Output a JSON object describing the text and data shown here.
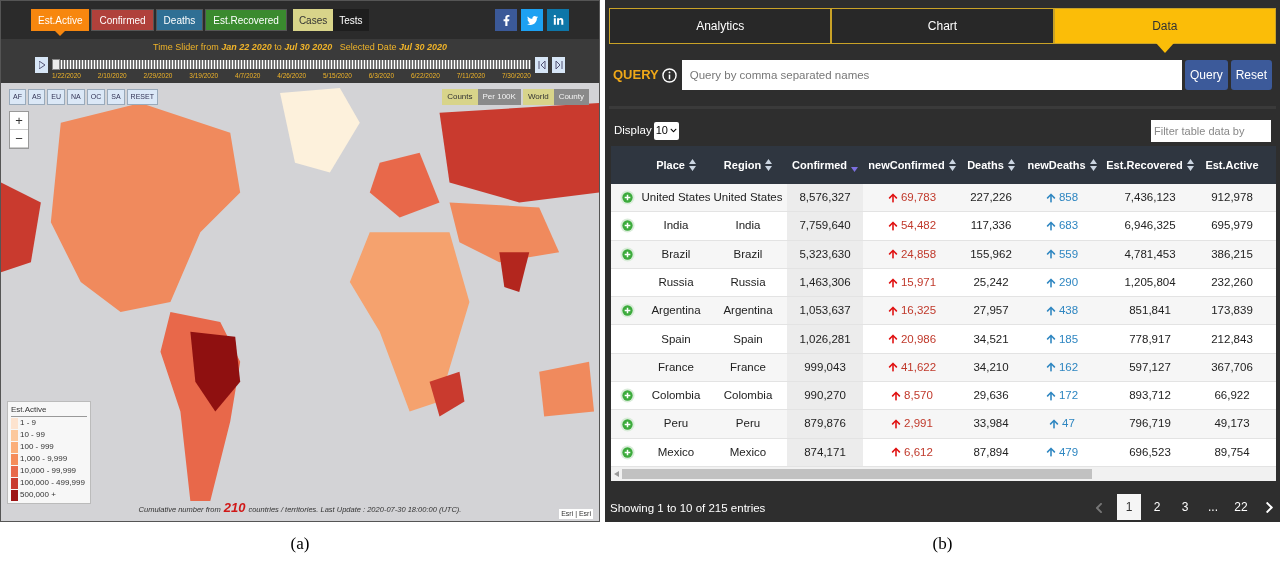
{
  "map_panel": {
    "metric_tabs": [
      {
        "label": "Est.Active",
        "selected": true,
        "color": "#f7870f"
      },
      {
        "label": "Confirmed",
        "selected": false,
        "color": "#b0413b"
      },
      {
        "label": "Deaths",
        "selected": false,
        "color": "#2f6f94"
      },
      {
        "label": "Est.Recovered",
        "selected": false,
        "color": "#3a8a2e"
      }
    ],
    "type_tabs": [
      {
        "label": "Cases",
        "selected": true
      },
      {
        "label": "Tests",
        "selected": false
      }
    ],
    "slider": {
      "title": "Time Slider from **Jan 22 2020** to **Jul 30 2020**   Selected Date **Jul 30 2020**",
      "level": 0.0,
      "ticks": [
        "1/22/2020",
        "2/10/2020",
        "2/29/2020",
        "3/19/2020",
        "4/7/2020",
        "4/26/2020",
        "5/15/2020",
        "6/3/2020",
        "6/22/2020",
        "7/11/2020",
        "7/30/2020"
      ]
    },
    "region_buttons": [
      "AF",
      "AS",
      "EU",
      "NA",
      "OC",
      "SA",
      "RESET"
    ],
    "mode_toggle": [
      {
        "label": "Counts",
        "selected": true
      },
      {
        "label": "Per 100K",
        "selected": false
      }
    ],
    "scope_toggle": [
      {
        "label": "World",
        "selected": true
      },
      {
        "label": "County",
        "selected": false
      }
    ],
    "zoom": [
      "+",
      "−"
    ],
    "legend": {
      "title": "Est.Active",
      "items": [
        {
          "label": "1 - 9",
          "color": "#fde3cf"
        },
        {
          "label": "10 - 99",
          "color": "#fcc89c"
        },
        {
          "label": "100 - 999",
          "color": "#fbae79"
        },
        {
          "label": "1,000 - 9,999",
          "color": "#f58c5a"
        },
        {
          "label": "10,000 - 99,999",
          "color": "#e8684a"
        },
        {
          "label": "100,000 - 499,999",
          "color": "#c93a2e"
        },
        {
          "label": "500,000 +",
          "color": "#9e1414"
        }
      ]
    },
    "footer": {
      "prefix": "Cumulative number from",
      "count": "210",
      "suffix": "countries / territories. Last Update : 2020-07-30 18:00:00 (UTC)."
    },
    "attribution": "Esri | Esri",
    "caption": "(a)"
  },
  "data_panel": {
    "tabs": [
      {
        "label": "Analytics",
        "selected": false
      },
      {
        "label": "Chart",
        "selected": false
      },
      {
        "label": "Data",
        "selected": true
      }
    ],
    "query": {
      "label": "QUERY",
      "placeholder": "Query by comma separated names",
      "buttons": [
        "Query",
        "Reset"
      ]
    },
    "display": {
      "label": "Display",
      "value": "10"
    },
    "filter": {
      "placeholder": "Filter table data by"
    },
    "columns": [
      {
        "label": "Place",
        "sorted": false
      },
      {
        "label": "Region",
        "sorted": false
      },
      {
        "label": "Confirmed",
        "sorted": true
      },
      {
        "label": "newConfirmed",
        "sorted": false
      },
      {
        "label": "Deaths",
        "sorted": false
      },
      {
        "label": "newDeaths",
        "sorted": false
      },
      {
        "label": "Est.Recovered",
        "sorted": false
      },
      {
        "label": "Est.Active"
      }
    ],
    "rows": [
      {
        "expandable": true,
        "cells": [
          "United States",
          "United States",
          "8,576,327",
          "69,783",
          "227,226",
          "858",
          "7,436,123",
          "912,978"
        ]
      },
      {
        "expandable": true,
        "cells": [
          "India",
          "India",
          "7,759,640",
          "54,482",
          "117,336",
          "683",
          "6,946,325",
          "695,979"
        ]
      },
      {
        "expandable": true,
        "cells": [
          "Brazil",
          "Brazil",
          "5,323,630",
          "24,858",
          "155,962",
          "559",
          "4,781,453",
          "386,215"
        ]
      },
      {
        "expandable": false,
        "cells": [
          "Russia",
          "Russia",
          "1,463,306",
          "15,971",
          "25,242",
          "290",
          "1,205,804",
          "232,260"
        ]
      },
      {
        "expandable": true,
        "cells": [
          "Argentina",
          "Argentina",
          "1,053,637",
          "16,325",
          "27,957",
          "438",
          "851,841",
          "173,839"
        ]
      },
      {
        "expandable": false,
        "cells": [
          "Spain",
          "Spain",
          "1,026,281",
          "20,986",
          "34,521",
          "185",
          "778,917",
          "212,843"
        ]
      },
      {
        "expandable": false,
        "cells": [
          "France",
          "France",
          "999,043",
          "41,622",
          "34,210",
          "162",
          "597,127",
          "367,706"
        ]
      },
      {
        "expandable": true,
        "cells": [
          "Colombia",
          "Colombia",
          "990,270",
          "8,570",
          "29,636",
          "172",
          "893,712",
          "66,922"
        ]
      },
      {
        "expandable": true,
        "cells": [
          "Peru",
          "Peru",
          "879,876",
          "2,991",
          "33,984",
          "47",
          "796,719",
          "49,173"
        ]
      },
      {
        "expandable": true,
        "cells": [
          "Mexico",
          "Mexico",
          "874,171",
          "6,612",
          "87,894",
          "479",
          "696,523",
          "89,754"
        ]
      }
    ],
    "summary": "Showing 1 to 10 of 215 entries",
    "pages": [
      {
        "label": "1",
        "selected": true
      },
      {
        "label": "2",
        "selected": false
      },
      {
        "label": "3",
        "selected": false
      },
      {
        "label": "...",
        "selected": false
      },
      {
        "label": "22",
        "selected": false
      }
    ],
    "caption": "(b)"
  }
}
